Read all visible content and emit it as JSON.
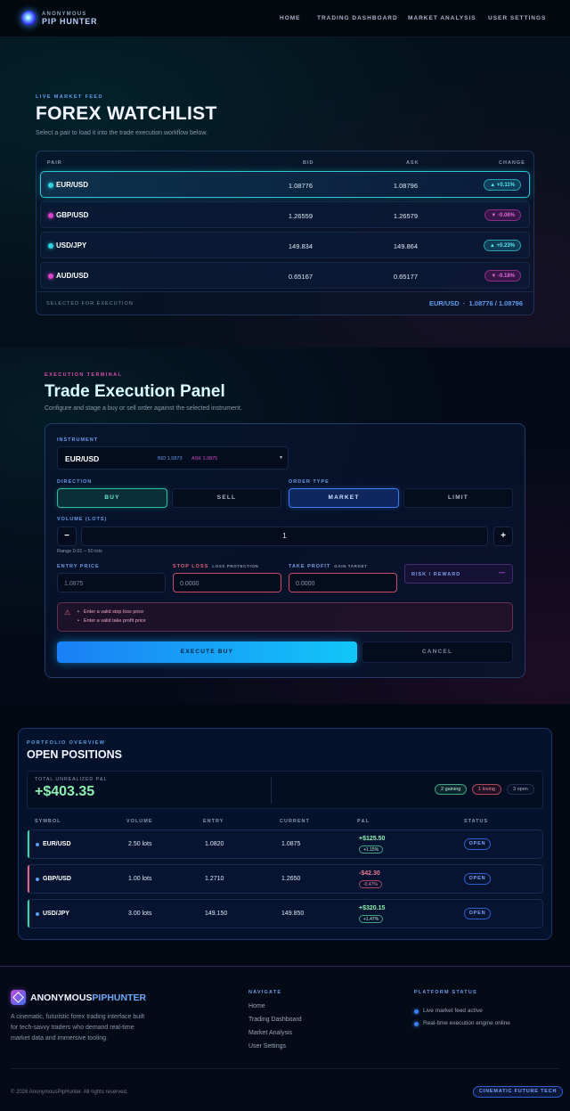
{
  "nav": {
    "brand_top": "ANONYMOUS",
    "brand_bottom": "PIP HUNTER",
    "links": [
      "HOME",
      "TRADING DASHBOARD",
      "MARKET ANALYSIS",
      "USER SETTINGS"
    ]
  },
  "watchlist": {
    "eyebrow": "LIVE MARKET FEED",
    "title": "FOREX WATCHLIST",
    "subtitle": "Select a pair to load it into the trade execution workflow below.",
    "columns": [
      "PAIR",
      "BID",
      "ASK",
      "CHANGE"
    ],
    "rows": [
      {
        "pair": "EUR/USD",
        "bid": "1.08776",
        "ask": "1.08796",
        "change": "▲ +0.11%",
        "dir": "up",
        "dot": "#2fd2e0"
      },
      {
        "pair": "GBP/USD",
        "bid": "1.26559",
        "ask": "1.26579",
        "change": "▼ -0.06%",
        "dir": "down",
        "dot": "#d743c9"
      },
      {
        "pair": "USD/JPY",
        "bid": "149.834",
        "ask": "149.864",
        "change": "▲ +0.23%",
        "dir": "up",
        "dot": "#2fd2e0"
      },
      {
        "pair": "AUD/USD",
        "bid": "0.65167",
        "ask": "0.65177",
        "change": "▼ -0.18%",
        "dir": "down",
        "dot": "#d743c9"
      }
    ],
    "selected_label": "SELECTED FOR EXECUTION",
    "selected_value": "EUR/USD  ·  1.08776 / 1.08796"
  },
  "trade": {
    "eyebrow": "EXECUTION TERMINAL",
    "title": "Trade Execution Panel",
    "subtitle": "Configure and stage a buy or sell order against the selected instrument.",
    "instrument_label": "INSTRUMENT",
    "instrument_value": "EUR/USD",
    "instrument_bid": "BID 1.0873",
    "instrument_ask": "ASK 1.0875",
    "direction_label": "DIRECTION",
    "buy": "BUY",
    "sell": "SELL",
    "order_type_label": "ORDER TYPE",
    "market": "MARKET",
    "limit": "LIMIT",
    "volume_label": "VOLUME (LOTS)",
    "minus": "−",
    "plus": "+",
    "volume_value": "1",
    "volume_range": "Range 0.01 – 50 lots",
    "entry_label": "ENTRY PRICE",
    "entry_placeholder": "1.0875",
    "sl_label": "STOP LOSS",
    "sl_hint": "LOSS PROTECTION",
    "sl_placeholder": "0.0000",
    "tp_label": "TAKE PROFIT",
    "tp_hint": "GAIN TARGET",
    "tp_placeholder": "0.0000",
    "rr_label": "RISK / REWARD",
    "rr_value": "—",
    "errors": [
      "Enter a valid stop loss price",
      "Enter a valid take profit price"
    ],
    "execute": "EXECUTE BUY",
    "cancel": "CANCEL"
  },
  "positions": {
    "eyebrow": "PORTFOLIO OVERVIEW",
    "title": "OPEN POSITIONS",
    "pnl_label": "TOTAL UNREALIZED P&L",
    "pnl_value": "+$403.35",
    "gaining": "2 gaining",
    "losing": "1 losing",
    "open_count": "3 open",
    "columns": [
      "SYMBOL",
      "VOLUME",
      "ENTRY",
      "CURRENT",
      "P&L",
      "STATUS"
    ],
    "rows": [
      {
        "symbol": "EUR/USD",
        "volume": "2.50 lots",
        "entry": "1.0820",
        "current": "1.0875",
        "pnl": "+$125.50",
        "pct": "+1.15%",
        "status": "OPEN",
        "dir": "up"
      },
      {
        "symbol": "GBP/USD",
        "volume": "1.00 lots",
        "entry": "1.2710",
        "current": "1.2650",
        "pnl": "-$42.30",
        "pct": "-0.47%",
        "status": "OPEN",
        "dir": "down"
      },
      {
        "symbol": "USD/JPY",
        "volume": "3.00 lots",
        "entry": "149.150",
        "current": "149.850",
        "pnl": "+$320.15",
        "pct": "+1.47%",
        "status": "OPEN",
        "dir": "up"
      }
    ]
  },
  "footer": {
    "brand_a": "ANONYMOUS",
    "brand_b": "PIPHUNTER",
    "description": [
      "A cinematic, futuristic forex trading interface built",
      "for tech-savvy traders who demand real-time",
      "market data and immersive tooling."
    ],
    "nav_heading": "NAVIGATE",
    "nav_links": [
      "Home",
      "Trading Dashboard",
      "Market Analysis",
      "User Settings"
    ],
    "status_heading": "PLATFORM STATUS",
    "status_items": [
      "Live market feed active",
      "Real-time execution engine online"
    ],
    "copyright": "© 2026 AnonymousPipHunter. All rights reserved.",
    "tag": "CINEMATIC FUTURE TECH"
  }
}
